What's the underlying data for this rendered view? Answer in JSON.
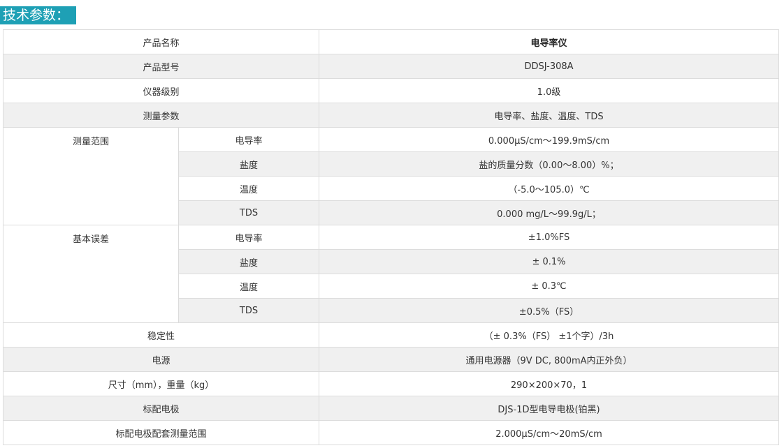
{
  "heading": "技术参数：",
  "rows": [
    {
      "label": "产品名称",
      "value": "电导率仪"
    },
    {
      "label": "产品型号",
      "value": "DDSJ-308A"
    },
    {
      "label": "仪器级别",
      "value": "1.0级"
    },
    {
      "label": "测量参数",
      "value": "电导率、盐度、温度、TDS"
    }
  ],
  "range_group": {
    "label": "测量范围",
    "items": [
      {
        "sub": "电导率",
        "value": "0.000μS/cm～199.9mS/cm"
      },
      {
        "sub": "盐度",
        "value": "盐的质量分数（0.00～8.00）%；"
      },
      {
        "sub": "温度",
        "value": "（-5.0～105.0）℃"
      },
      {
        "sub": "TDS",
        "value": "0.000 mg/L～99.9g/L；"
      }
    ]
  },
  "error_group": {
    "label": "基本误差",
    "items": [
      {
        "sub": "电导率",
        "value": "±1.0%FS"
      },
      {
        "sub": "盐度",
        "value": "± 0.1%"
      },
      {
        "sub": "温度",
        "value": "± 0.3℃"
      },
      {
        "sub": "TDS",
        "value": "±0.5%（FS）"
      }
    ]
  },
  "rows_after": [
    {
      "label": "稳定性",
      "value": "（± 0.3%（FS） ±1个字）/3h"
    },
    {
      "label": "电源",
      "value": "通用电源器（9V DC, 800mA内正外负）"
    },
    {
      "label": "尺寸（mm），重量（kg）",
      "value": "290×200×70，1"
    },
    {
      "label": "标配电极",
      "value": "DJS-1D型电导电极(铂黑)"
    },
    {
      "label": "标配电极配套测量范围",
      "value": "2.000μS/cm～20mS/cm"
    }
  ],
  "colors": {
    "heading_bg": "#1ea0b5",
    "row_alt_bg": "#f0f0f0",
    "border": "#dcdcdc"
  }
}
